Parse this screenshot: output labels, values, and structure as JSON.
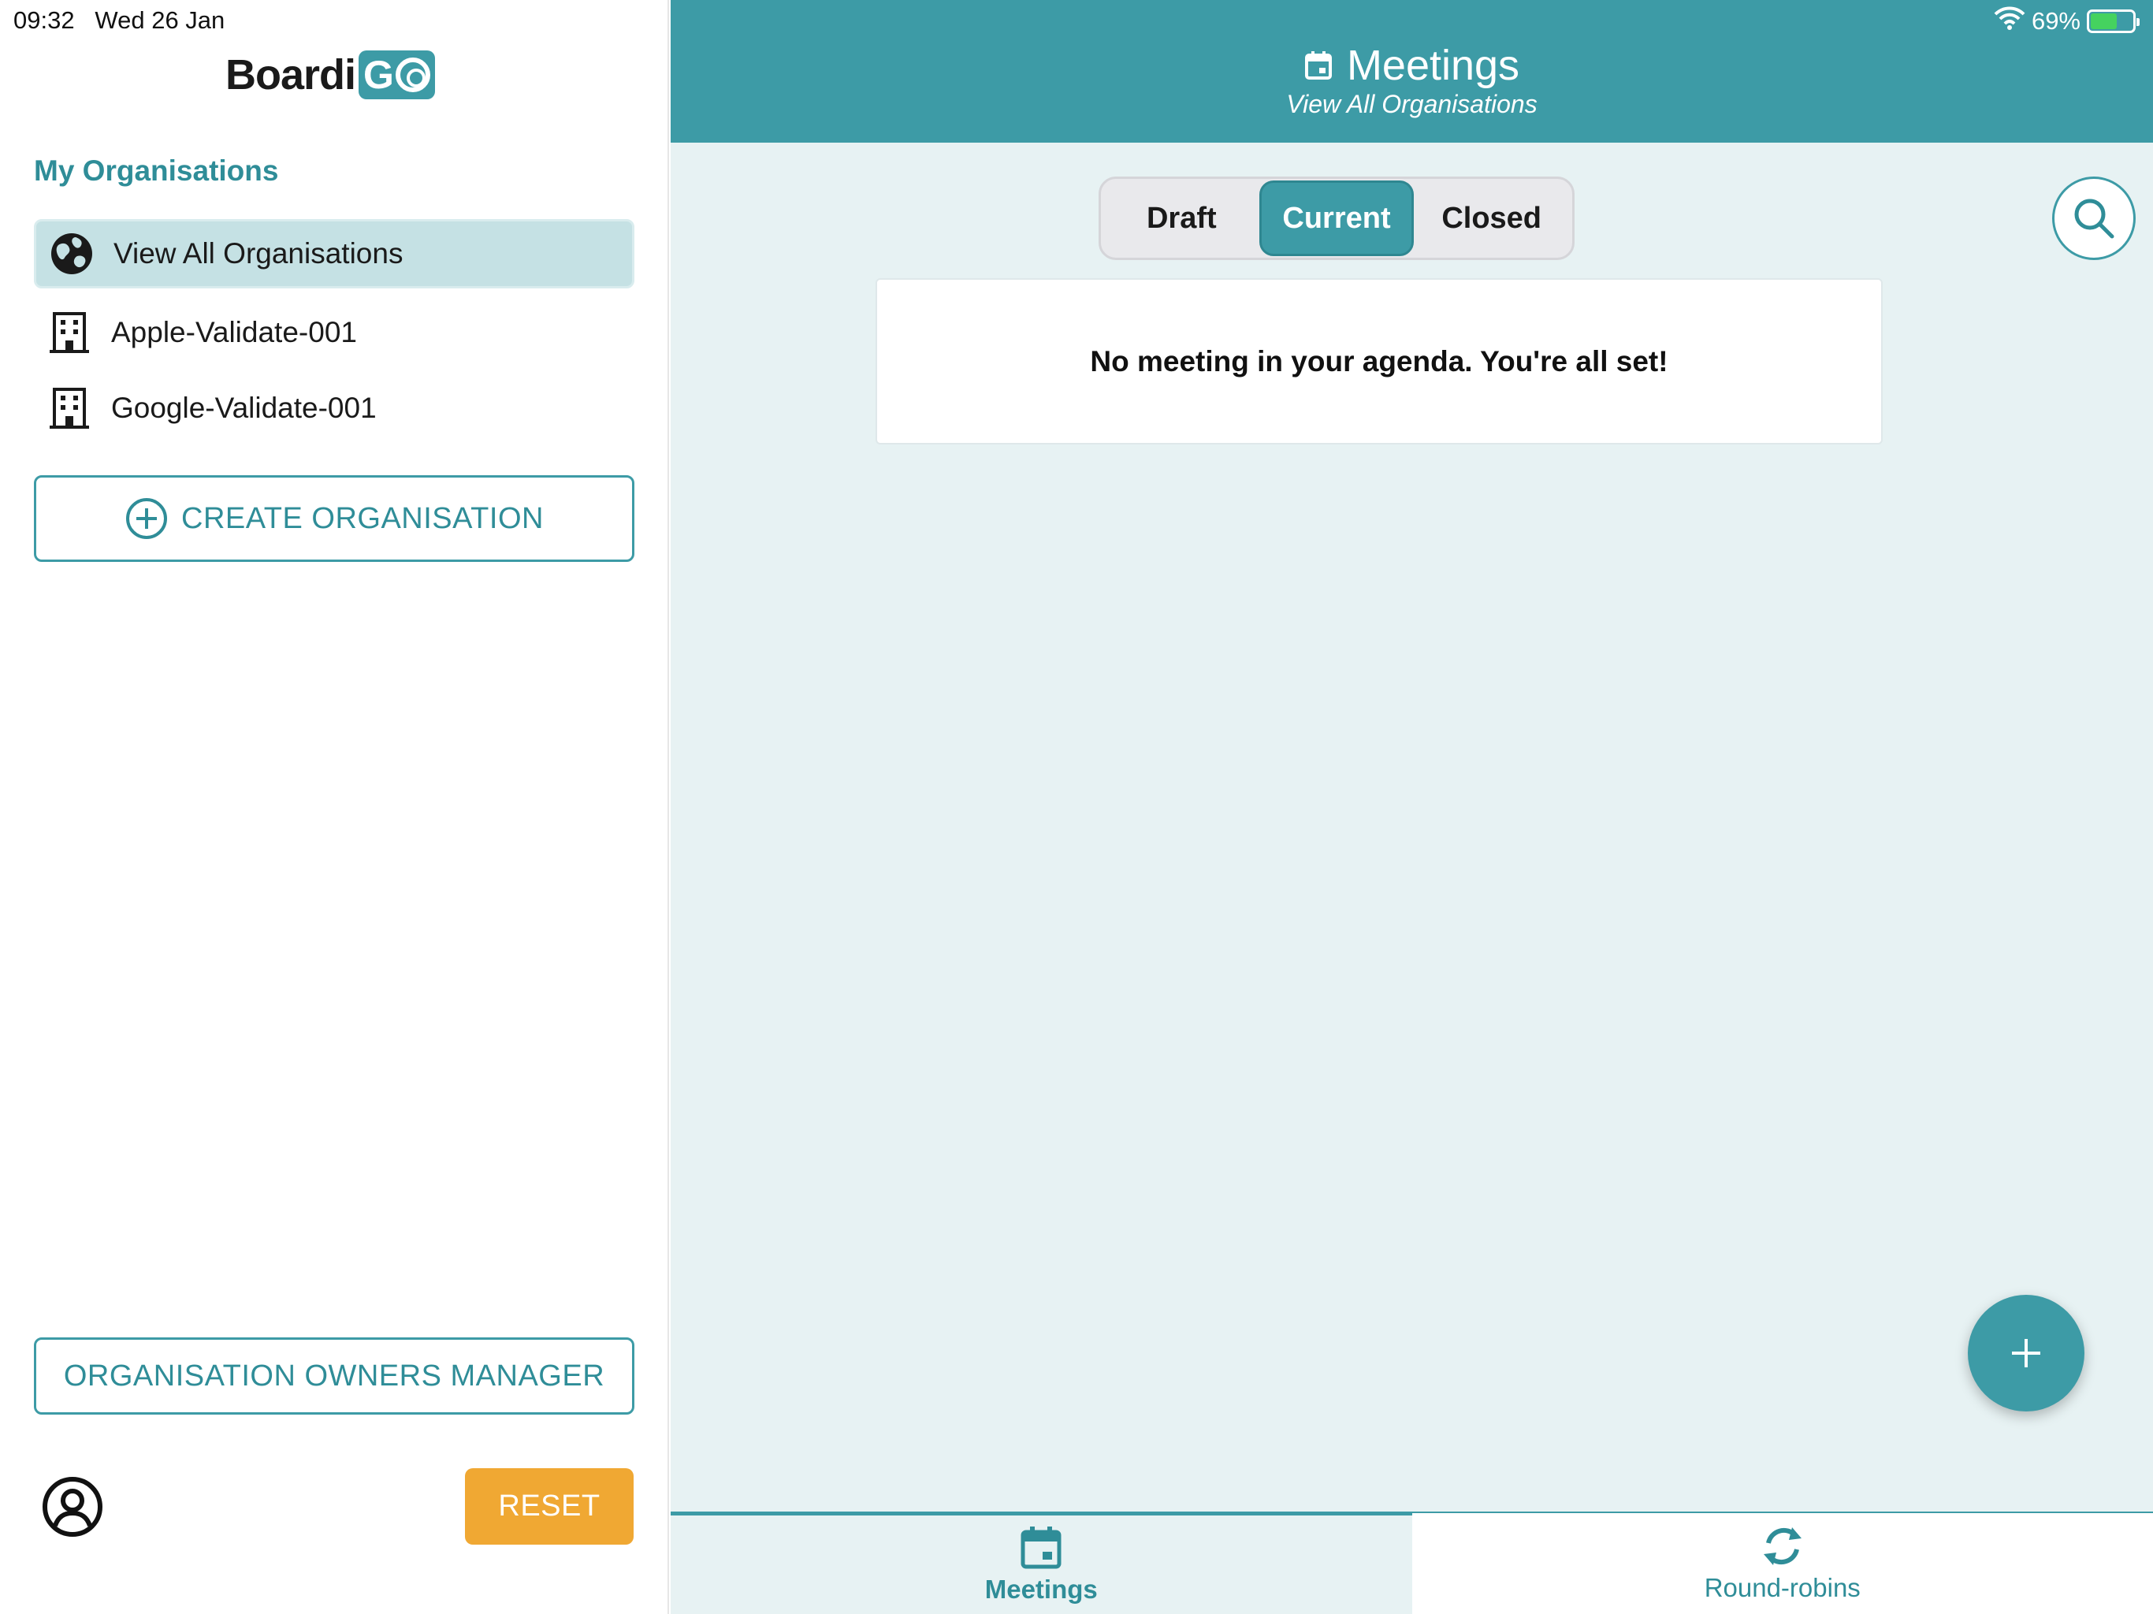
{
  "status_bar": {
    "time": "09:32",
    "date": "Wed 26 Jan",
    "battery": "69%"
  },
  "logo": {
    "text": "Boardi",
    "box_text": "G"
  },
  "sidebar": {
    "section_title": "My Organisations",
    "items": [
      {
        "label": "View All Organisations",
        "icon": "globe-icon",
        "selected": true
      },
      {
        "label": "Apple-Validate-001",
        "icon": "building-icon"
      },
      {
        "label": "Google-Validate-001",
        "icon": "building-icon"
      }
    ],
    "create_label": "CREATE ORGANISATION",
    "owners_label": "ORGANISATION OWNERS MANAGER",
    "reset_label": "RESET"
  },
  "header": {
    "title": "Meetings",
    "subtitle": "View All Organisations"
  },
  "tabs": {
    "draft": "Draft",
    "current": "Current",
    "closed": "Closed",
    "selected": "current"
  },
  "main": {
    "empty_message": "No meeting in your agenda. You're all set!"
  },
  "bottom_nav": {
    "meetings": "Meetings",
    "round_robins": "Round-robins"
  },
  "colors": {
    "accent": "#3d9ba6",
    "accent_text": "#2f8d98",
    "reset": "#f0a833",
    "main_bg": "#e7f2f3",
    "selected_bg": "#c5e1e4"
  }
}
